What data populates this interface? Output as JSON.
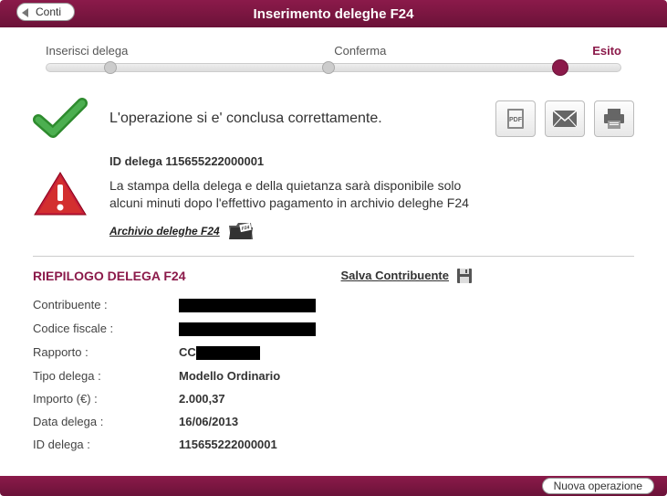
{
  "header": {
    "back_label": "Conti",
    "title": "Inserimento deleghe F24"
  },
  "stepper": {
    "step1": "Inserisci delega",
    "step2": "Conferma",
    "step3": "Esito"
  },
  "result": {
    "success_message": "L'operazione si e' conclusa correttamente.",
    "id_label": "ID delega",
    "id_value": "115655222000001",
    "warning_text": "La stampa della delega e della quietanza sarà disponibile solo alcuni minuti dopo l'effettivo pagamento in archivio deleghe F24",
    "archive_link": "Archivio deleghe F24"
  },
  "summary": {
    "title": "RIEPILOGO DELEGA F24",
    "save_contrib": "Salva Contribuente",
    "rows": {
      "contribuente_label": "Contribuente :",
      "contribuente_value": "",
      "codfisc_label": "Codice fiscale :",
      "codfisc_value": "",
      "rapporto_label": "Rapporto :",
      "rapporto_prefix": "CC",
      "rapporto_value": "",
      "tipodelega_label": "Tipo delega :",
      "tipodelega_value": "Modello Ordinario",
      "importo_label": "Importo (€) :",
      "importo_value": "2.000,37",
      "datadelega_label": "Data delega :",
      "datadelega_value": "16/06/2013",
      "iddelega_label": "ID delega :",
      "iddelega_value": "115655222000001"
    }
  },
  "footer": {
    "new_op": "Nuova operazione"
  }
}
